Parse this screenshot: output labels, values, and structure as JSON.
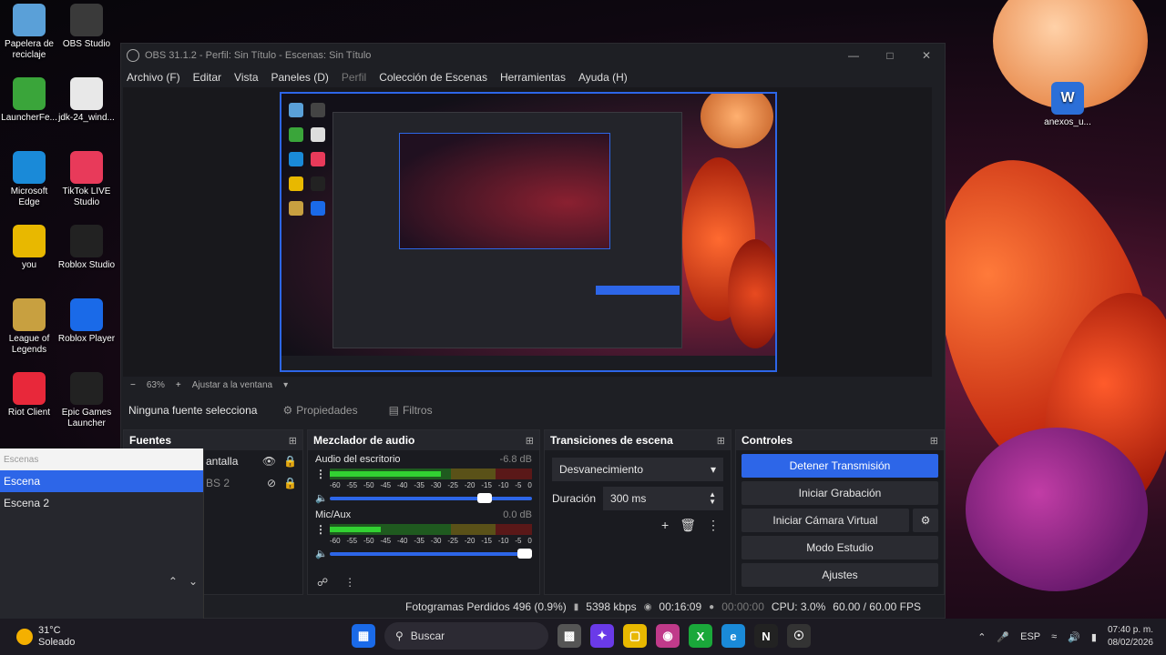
{
  "desktop": {
    "icons": [
      {
        "label": "Papelera de reciclaje",
        "icon": "recycle-bin-icon",
        "color": "#5aa0d8"
      },
      {
        "label": "OBS Studio",
        "icon": "obs-icon",
        "color": "#3a3a3a"
      },
      {
        "label": "LauncherFe...",
        "icon": "minecraft-icon",
        "color": "#3aa53a"
      },
      {
        "label": "jdk-24_wind...",
        "icon": "java-icon",
        "color": "#e8e8e8"
      },
      {
        "label": "Microsoft Edge",
        "icon": "edge-icon",
        "color": "#1a8ad8"
      },
      {
        "label": "TikTok LIVE Studio",
        "icon": "tiktok-icon",
        "color": "#e83a5a"
      },
      {
        "label": "you",
        "icon": "chrome-icon",
        "color": "#e8b800"
      },
      {
        "label": "Roblox Studio",
        "icon": "roblox-studio-icon",
        "color": "#222222"
      },
      {
        "label": "League of Legends",
        "icon": "league-icon",
        "color": "#c8a040"
      },
      {
        "label": "Roblox Player",
        "icon": "roblox-icon",
        "color": "#1a6ae8"
      },
      {
        "label": "Riot Client",
        "icon": "riot-icon",
        "color": "#e8283a"
      },
      {
        "label": "Epic Games Launcher",
        "icon": "epic-icon",
        "color": "#222222"
      }
    ],
    "right_icon_label": "anexos_u..."
  },
  "obs": {
    "title": "OBS 31.1.2 - Perfil: Sin Título - Escenas: Sin Título",
    "menu": [
      "Archivo (F)",
      "Editar",
      "Vista",
      "Paneles (D)",
      "Perfil",
      "Colección de Escenas",
      "Herramientas",
      "Ayuda (H)"
    ],
    "zoom": {
      "minus": "−",
      "level": "63%",
      "plus": "+",
      "fit": "Ajustar a la ventana"
    },
    "source_bar": {
      "none": "Ninguna fuente selecciona",
      "props": "Propiedades",
      "filters": "Filtros"
    },
    "docks": {
      "sources": {
        "title": "Fuentes",
        "items": [
          "antalla",
          "BS 2"
        ]
      },
      "mixer": {
        "title": "Mezclador de audio",
        "channels": [
          {
            "name": "Audio del escritorio",
            "db": "-6.8 dB",
            "level": 0.55,
            "volume": 0.8
          },
          {
            "name": "Mic/Aux",
            "db": "0.0 dB",
            "level": 0.25,
            "volume": 1.0
          }
        ],
        "scale": [
          "-60",
          "-55",
          "-50",
          "-45",
          "-40",
          "-35",
          "-30",
          "-25",
          "-20",
          "-15",
          "-10",
          "-5",
          "0"
        ]
      },
      "transitions": {
        "title": "Transiciones de escena",
        "type": "Desvanecimiento",
        "duration_label": "Duración",
        "duration": "300 ms"
      },
      "controls": {
        "title": "Controles",
        "stop_stream": "Detener Transmisión",
        "start_record": "Iniciar Grabación",
        "virtual_cam": "Iniciar Cámara Virtual",
        "studio_mode": "Modo Estudio",
        "settings": "Ajustes"
      }
    },
    "status": {
      "dropped": "Fotogramas Perdidos 496 (0.9%)",
      "bitrate": "5398 kbps",
      "stream_time": "00:16:09",
      "rec_time": "00:00:00",
      "cpu": "CPU: 3.0%",
      "fps": "60.00 / 60.00 FPS"
    }
  },
  "scenes": {
    "title": "Escenas",
    "items": [
      "Escena",
      "Escena 2"
    ],
    "selected": 0
  },
  "taskbar": {
    "temp": "31°C",
    "weather": "Soleado",
    "search": "Buscar",
    "lang": "ESP",
    "time": "07:40 p. m.",
    "date": "08/02/2026"
  },
  "colors": {
    "accent": "#2d66e8"
  }
}
